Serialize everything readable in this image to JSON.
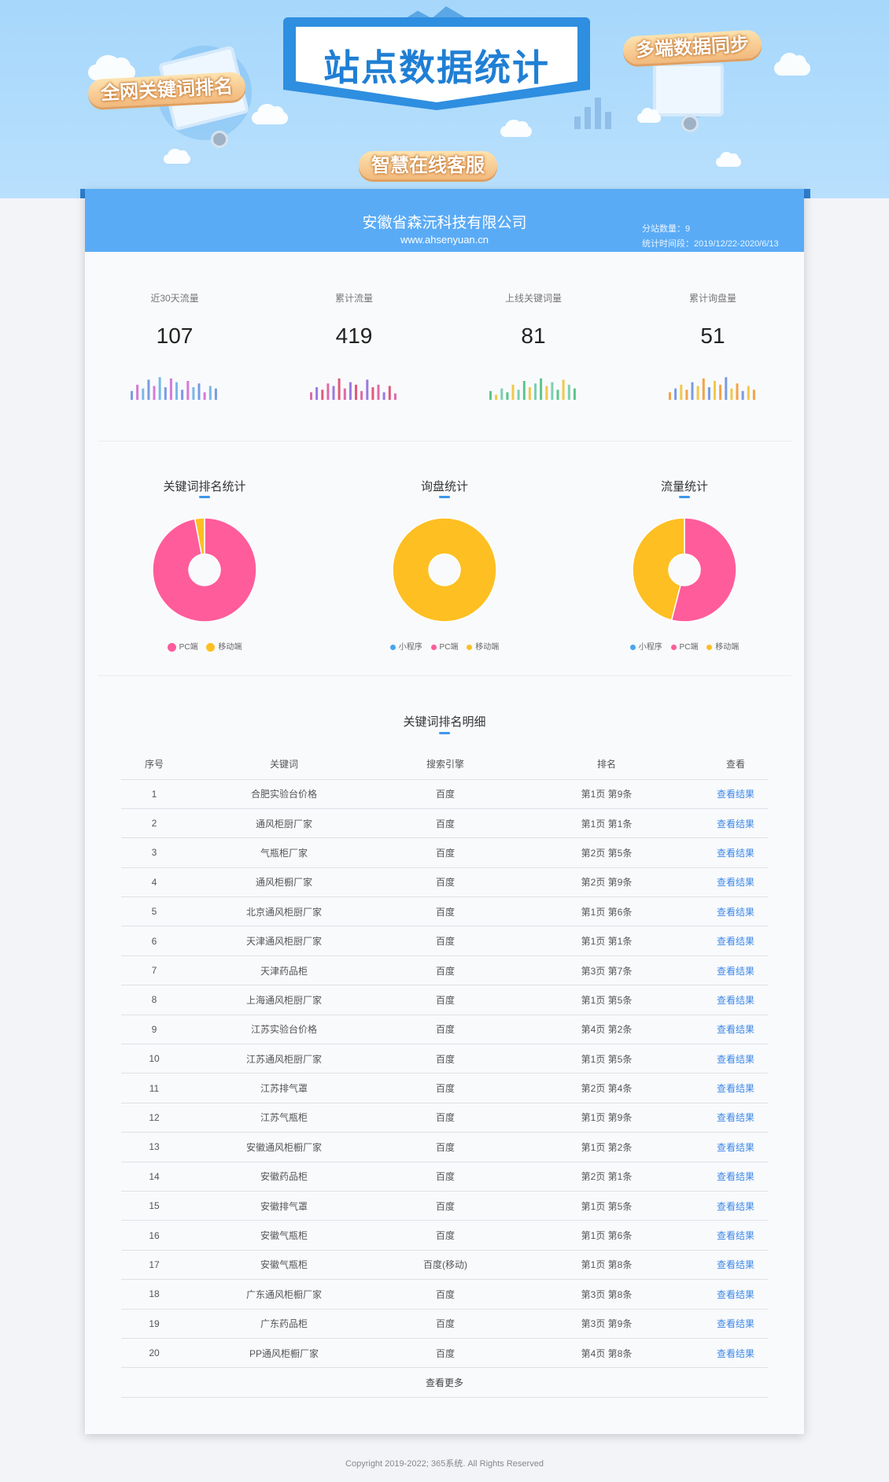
{
  "banner": {
    "title": "站点数据统计",
    "tag_left": "全网关键词排名",
    "tag_right": "多端数据同步",
    "tag_bottom": "智慧在线客服"
  },
  "header": {
    "company": "安徽省森沅科技有限公司",
    "domain": "www.ahsenyuan.cn",
    "substation_count": "分站数量：9",
    "stat_period": "统计时间段：2019/12/22-2020/6/13"
  },
  "stats": [
    {
      "label": "近30天流量",
      "value": "107",
      "color": "#7b8fe0",
      "colors": [
        "#7a9be3",
        "#d57ad8",
        "#7ab8e8"
      ],
      "bars": [
        0.35,
        0.6,
        0.45,
        0.8,
        0.55,
        0.9,
        0.5,
        0.85,
        0.7,
        0.4,
        0.75,
        0.5,
        0.65,
        0.3,
        0.55,
        0.45
      ]
    },
    {
      "label": "累计流量",
      "value": "419",
      "color": "#d66fc0",
      "colors": [
        "#e06aa6",
        "#9b7ae0",
        "#e05a7a"
      ],
      "bars": [
        0.3,
        0.5,
        0.4,
        0.65,
        0.55,
        0.85,
        0.45,
        0.7,
        0.6,
        0.35,
        0.8,
        0.5,
        0.6,
        0.3,
        0.55,
        0.25
      ]
    },
    {
      "label": "上线关键词量",
      "value": "81",
      "color": "#6cc48a",
      "colors": [
        "#5ec58a",
        "#f1c84a",
        "#7ad0b0"
      ],
      "bars": [
        0.35,
        0.2,
        0.45,
        0.3,
        0.6,
        0.4,
        0.75,
        0.5,
        0.65,
        0.85,
        0.55,
        0.7,
        0.4,
        0.8,
        0.6,
        0.45
      ]
    },
    {
      "label": "累计询盘量",
      "value": "51",
      "color": "#f3a34a",
      "colors": [
        "#f3a34a",
        "#7a9be3",
        "#f2c84a"
      ],
      "bars": [
        0.3,
        0.45,
        0.6,
        0.4,
        0.7,
        0.55,
        0.85,
        0.5,
        0.75,
        0.6,
        0.9,
        0.45,
        0.65,
        0.35,
        0.55,
        0.4
      ]
    }
  ],
  "charts": {
    "colors": {
      "mini": "#46a6f2",
      "pc": "#ff5c9b",
      "mobile": "#fdbf22"
    },
    "legend_labels": {
      "mini": "小程序",
      "pc": "PC端",
      "mobile": "移动端"
    }
  },
  "chart_data": [
    {
      "type": "pie",
      "title": "关键词排名统计",
      "categories": [
        "PC端",
        "移动端"
      ],
      "values": [
        97,
        3
      ]
    },
    {
      "type": "pie",
      "title": "询盘统计",
      "categories": [
        "小程序",
        "PC端",
        "移动端"
      ],
      "values": [
        0,
        0,
        100
      ]
    },
    {
      "type": "pie",
      "title": "流量统计",
      "categories": [
        "小程序",
        "PC端",
        "移动端"
      ],
      "values": [
        0,
        54,
        46
      ]
    }
  ],
  "table": {
    "title": "关键词排名明细",
    "headers": [
      "序号",
      "关键词",
      "搜索引擎",
      "排名",
      "查看"
    ],
    "view_label": "查看结果",
    "more_label": "查看更多",
    "rows": [
      {
        "no": "1",
        "keyword": "合肥实验台价格",
        "engine": "百度",
        "rank": "第1页 第9条"
      },
      {
        "no": "2",
        "keyword": "通风柜厨厂家",
        "engine": "百度",
        "rank": "第1页 第1条"
      },
      {
        "no": "3",
        "keyword": "气瓶柜厂家",
        "engine": "百度",
        "rank": "第2页 第5条"
      },
      {
        "no": "4",
        "keyword": "通风柜橱厂家",
        "engine": "百度",
        "rank": "第2页 第9条"
      },
      {
        "no": "5",
        "keyword": "北京通风柜厨厂家",
        "engine": "百度",
        "rank": "第1页 第6条"
      },
      {
        "no": "6",
        "keyword": "天津通风柜厨厂家",
        "engine": "百度",
        "rank": "第1页 第1条"
      },
      {
        "no": "7",
        "keyword": "天津药品柜",
        "engine": "百度",
        "rank": "第3页 第7条"
      },
      {
        "no": "8",
        "keyword": "上海通风柜厨厂家",
        "engine": "百度",
        "rank": "第1页 第5条"
      },
      {
        "no": "9",
        "keyword": "江苏实验台价格",
        "engine": "百度",
        "rank": "第4页 第2条"
      },
      {
        "no": "10",
        "keyword": "江苏通风柜厨厂家",
        "engine": "百度",
        "rank": "第1页 第5条"
      },
      {
        "no": "11",
        "keyword": "江苏排气罩",
        "engine": "百度",
        "rank": "第2页 第4条"
      },
      {
        "no": "12",
        "keyword": "江苏气瓶柜",
        "engine": "百度",
        "rank": "第1页 第9条"
      },
      {
        "no": "13",
        "keyword": "安徽通风柜橱厂家",
        "engine": "百度",
        "rank": "第1页 第2条"
      },
      {
        "no": "14",
        "keyword": "安徽药品柜",
        "engine": "百度",
        "rank": "第2页 第1条"
      },
      {
        "no": "15",
        "keyword": "安徽排气罩",
        "engine": "百度",
        "rank": "第1页 第5条"
      },
      {
        "no": "16",
        "keyword": "安徽气瓶柜",
        "engine": "百度",
        "rank": "第1页 第6条"
      },
      {
        "no": "17",
        "keyword": "安徽气瓶柜",
        "engine": "百度(移动)",
        "rank": "第1页 第8条"
      },
      {
        "no": "18",
        "keyword": "广东通风柜橱厂家",
        "engine": "百度",
        "rank": "第3页 第8条"
      },
      {
        "no": "19",
        "keyword": "广东药品柜",
        "engine": "百度",
        "rank": "第3页 第9条"
      },
      {
        "no": "20",
        "keyword": "PP通风柜橱厂家",
        "engine": "百度",
        "rank": "第4页 第8条"
      }
    ]
  },
  "footer": {
    "copyright": "Copyright 2019-2022; 365系统. All Rights Reserved"
  }
}
